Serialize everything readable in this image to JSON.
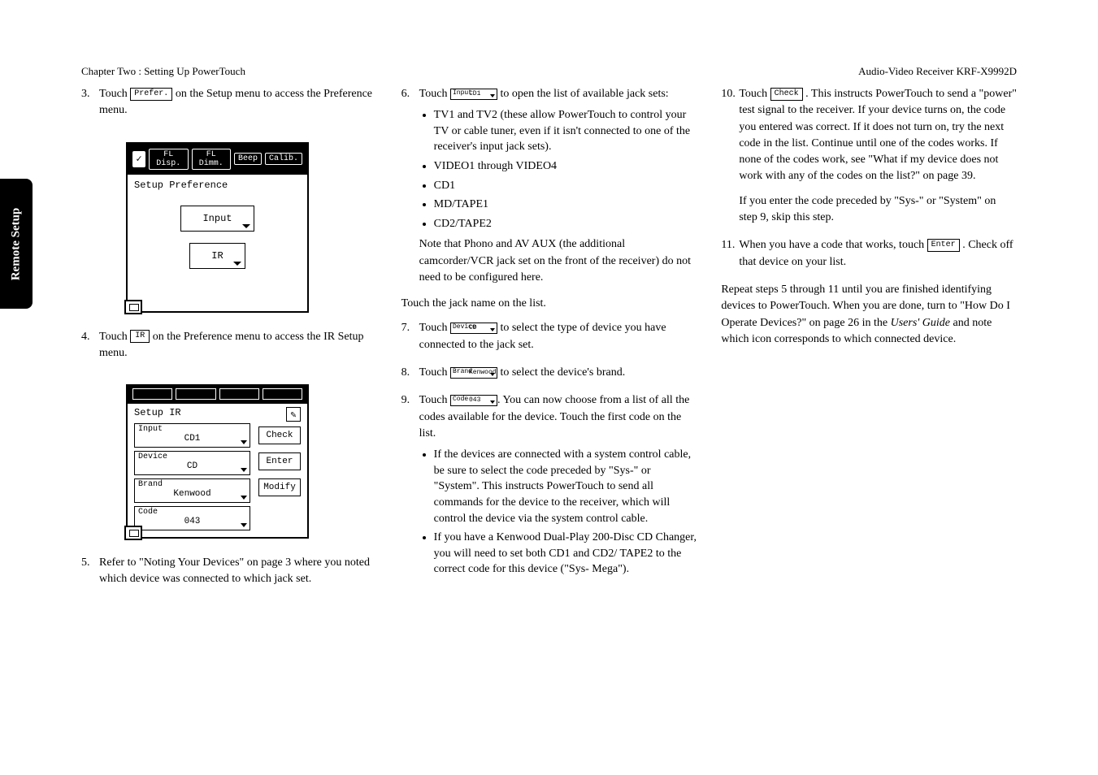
{
  "header": {
    "left": "Chapter Two : Setting Up PowerTouch",
    "right": "Audio-Video Receiver KRF-X9992D"
  },
  "sidetab": "Remote Setup",
  "col1": {
    "step3": {
      "num": "3.",
      "pre": "Touch ",
      "icon": "Prefer.",
      "post": " on the Setup menu to access the Preference menu."
    },
    "screen1": {
      "tabs": [
        "FL Disp.",
        "FL Dimm.",
        "Beep",
        "Calib."
      ],
      "title": "Setup Preference",
      "btn1": "Input",
      "btn2": "IR"
    },
    "step4": {
      "num": "4.",
      "pre": "Touch ",
      "icon": "IR",
      "post": " on the Preference menu to access the IR Setup menu."
    },
    "screen2": {
      "title": "Setup IR",
      "fields": [
        {
          "label": "Input",
          "value": "CD1"
        },
        {
          "label": "Device",
          "value": "CD"
        },
        {
          "label": "Brand",
          "value": "Kenwood"
        },
        {
          "label": "Code",
          "value": "043"
        }
      ],
      "buttons": [
        "Check",
        "Enter",
        "Modify"
      ]
    },
    "step5": {
      "num": "5.",
      "text": "Refer to \"Noting Your Devices\" on page 3 where you noted which device was connected to which jack set."
    }
  },
  "col2": {
    "step6": {
      "num": "6.",
      "pre": "Touch ",
      "field": {
        "label": "Input",
        "value": "CD1"
      },
      "post": " to open the list of available jack sets:"
    },
    "step6_bullets": [
      "TV1 and TV2 (these allow PowerTouch to control your TV or cable tuner, even if it isn't connected to one of the receiver's input jack sets).",
      "VIDEO1 through VIDEO4",
      "CD1",
      "MD/TAPE1",
      "CD2/TAPE2"
    ],
    "step6_note": "Note that Phono and AV AUX (the additional camcorder/VCR jack set on the front of the receiver) do not need to be configured here.",
    "touch_jack": "Touch the jack name on the list.",
    "step7": {
      "num": "7.",
      "pre": "Touch ",
      "field": {
        "label": "Device",
        "value": "CD"
      },
      "post": " to select the type of device you have connected to the jack set."
    },
    "step8": {
      "num": "8.",
      "pre": "Touch ",
      "field": {
        "label": "Brand",
        "value": "Kenwood"
      },
      "post": " to select the device's brand."
    },
    "step9": {
      "num": "9.",
      "pre": "Touch ",
      "field": {
        "label": "Code",
        "value": "043"
      },
      "post": ". You can now choose from a list of all the codes available for the device. Touch the first code on the list."
    },
    "step9_bullets": [
      "If the devices are connected with a system control cable, be sure to select the code preceded by \"Sys-\" or \"System\". This instructs PowerTouch to send all commands for the device to the receiver, which will control the device via the system control cable.",
      "If you have a Kenwood Dual-Play 200-Disc CD Changer, you will need to set both CD1 and CD2/ TAPE2 to the correct code for this device (\"Sys- Mega\")."
    ]
  },
  "col3": {
    "step10": {
      "num": "10.",
      "pre": "Touch ",
      "icon": "Check",
      "post": " . This instructs PowerTouch to send a \"power\" test signal to the receiver. If your device turns on, the code you entered was correct. If it does not turn on, try the next code in the list. Continue until one of the codes works. If none of the codes work, see \"What if my device does not work with any of the codes on the list?\" on page 39."
    },
    "step10_note": "If you enter the code preceded by \"Sys-\" or \"System\" on step 9, skip this step.",
    "step11": {
      "num": "11.",
      "pre": "When you have a code that works, touch ",
      "icon": "Enter",
      "post": " . Check off that device on your list."
    },
    "repeat_a": "Repeat steps 5 through 11 until you are finished identifying devices to PowerTouch. When you are done, turn to \"How Do I Operate Devices?\" on page 26 in the ",
    "repeat_em": "Users' Guide",
    "repeat_b": " and note which icon corresponds to which connected device."
  }
}
